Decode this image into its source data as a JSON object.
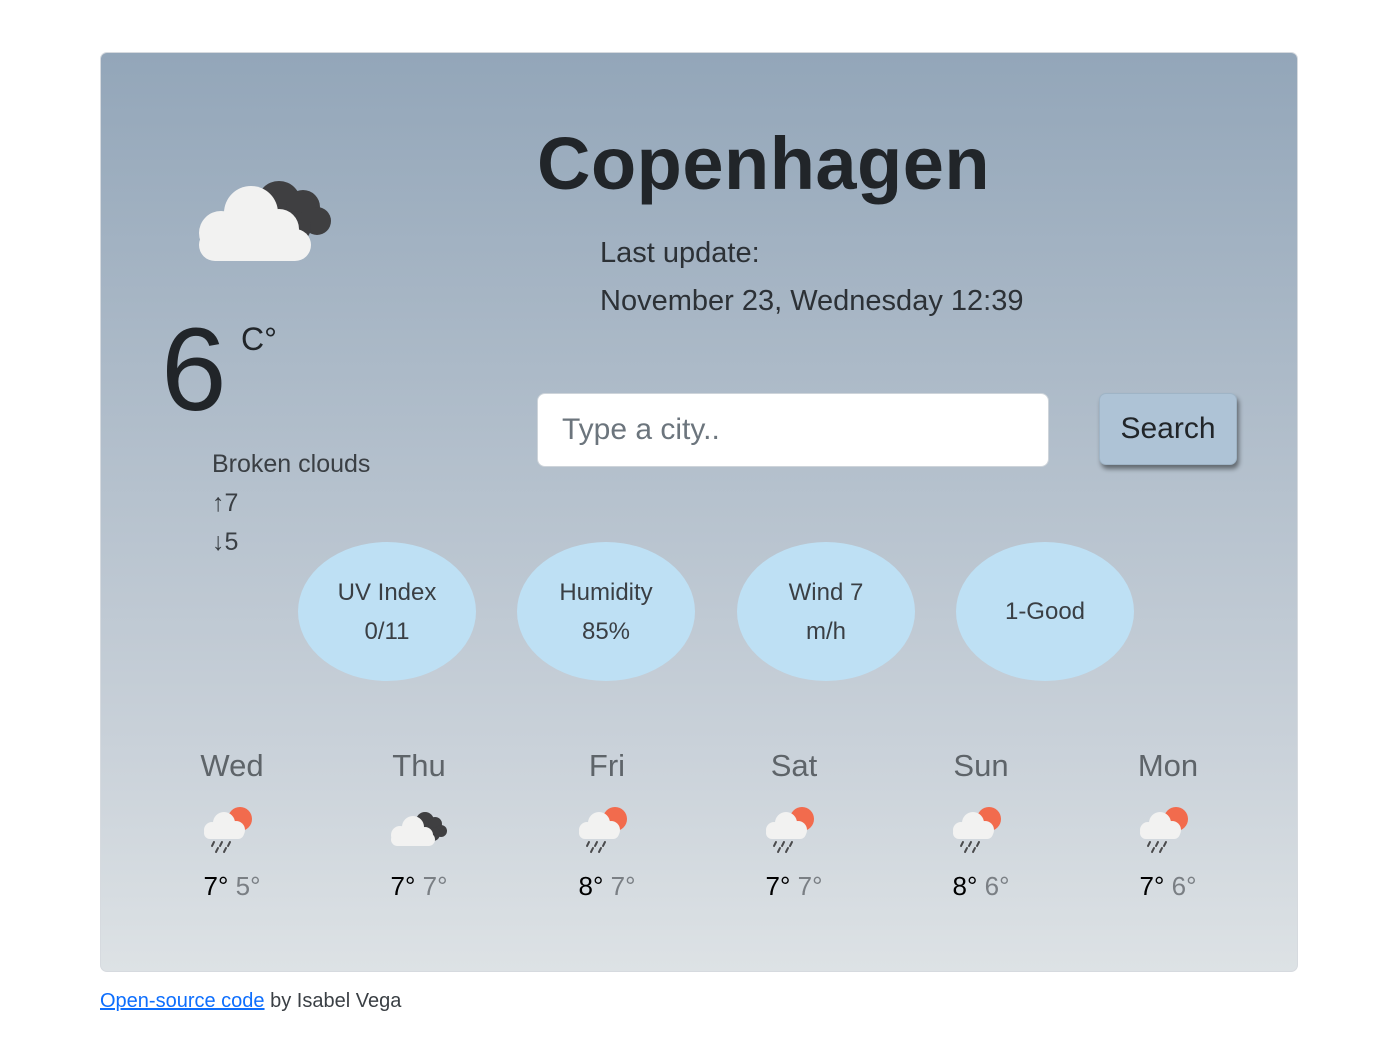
{
  "current": {
    "city": "Copenhagen",
    "update_label": "Last update:",
    "update_time": "November 23, Wednesday 12:39",
    "temperature": "6",
    "unit": "C°",
    "description": "Broken clouds",
    "high": "↑7",
    "low": "↓5",
    "icon": "broken-clouds-icon"
  },
  "search": {
    "placeholder": "Type a city..",
    "value": "",
    "button_label": "Search"
  },
  "stats": [
    {
      "line1": "UV Index",
      "line2": "0/11"
    },
    {
      "line1": "Humidity",
      "line2": "85%"
    },
    {
      "line1": "Wind 7",
      "line2": "m/h"
    },
    {
      "line1": "1-Good",
      "line2": ""
    }
  ],
  "forecast": [
    {
      "day": "Wed",
      "max": "7°",
      "min": "5°",
      "icon": "sun-rain-cloud-icon"
    },
    {
      "day": "Thu",
      "max": "7°",
      "min": "7°",
      "icon": "broken-clouds-icon"
    },
    {
      "day": "Fri",
      "max": "8°",
      "min": "7°",
      "icon": "sun-rain-cloud-icon"
    },
    {
      "day": "Sat",
      "max": "7°",
      "min": "7°",
      "icon": "sun-rain-cloud-icon"
    },
    {
      "day": "Sun",
      "max": "8°",
      "min": "6°",
      "icon": "sun-rain-cloud-icon"
    },
    {
      "day": "Mon",
      "max": "7°",
      "min": "6°",
      "icon": "sun-rain-cloud-icon"
    }
  ],
  "footer": {
    "link_text": "Open-source code",
    "byline": " by Isabel Vega"
  },
  "colors": {
    "card_top": "#93a6b9",
    "card_bottom": "#dde2e5",
    "stat_bubble": "#bee0f4",
    "button": "#aec3d6",
    "sun": "#f26b4d",
    "link": "#0d6efd"
  }
}
